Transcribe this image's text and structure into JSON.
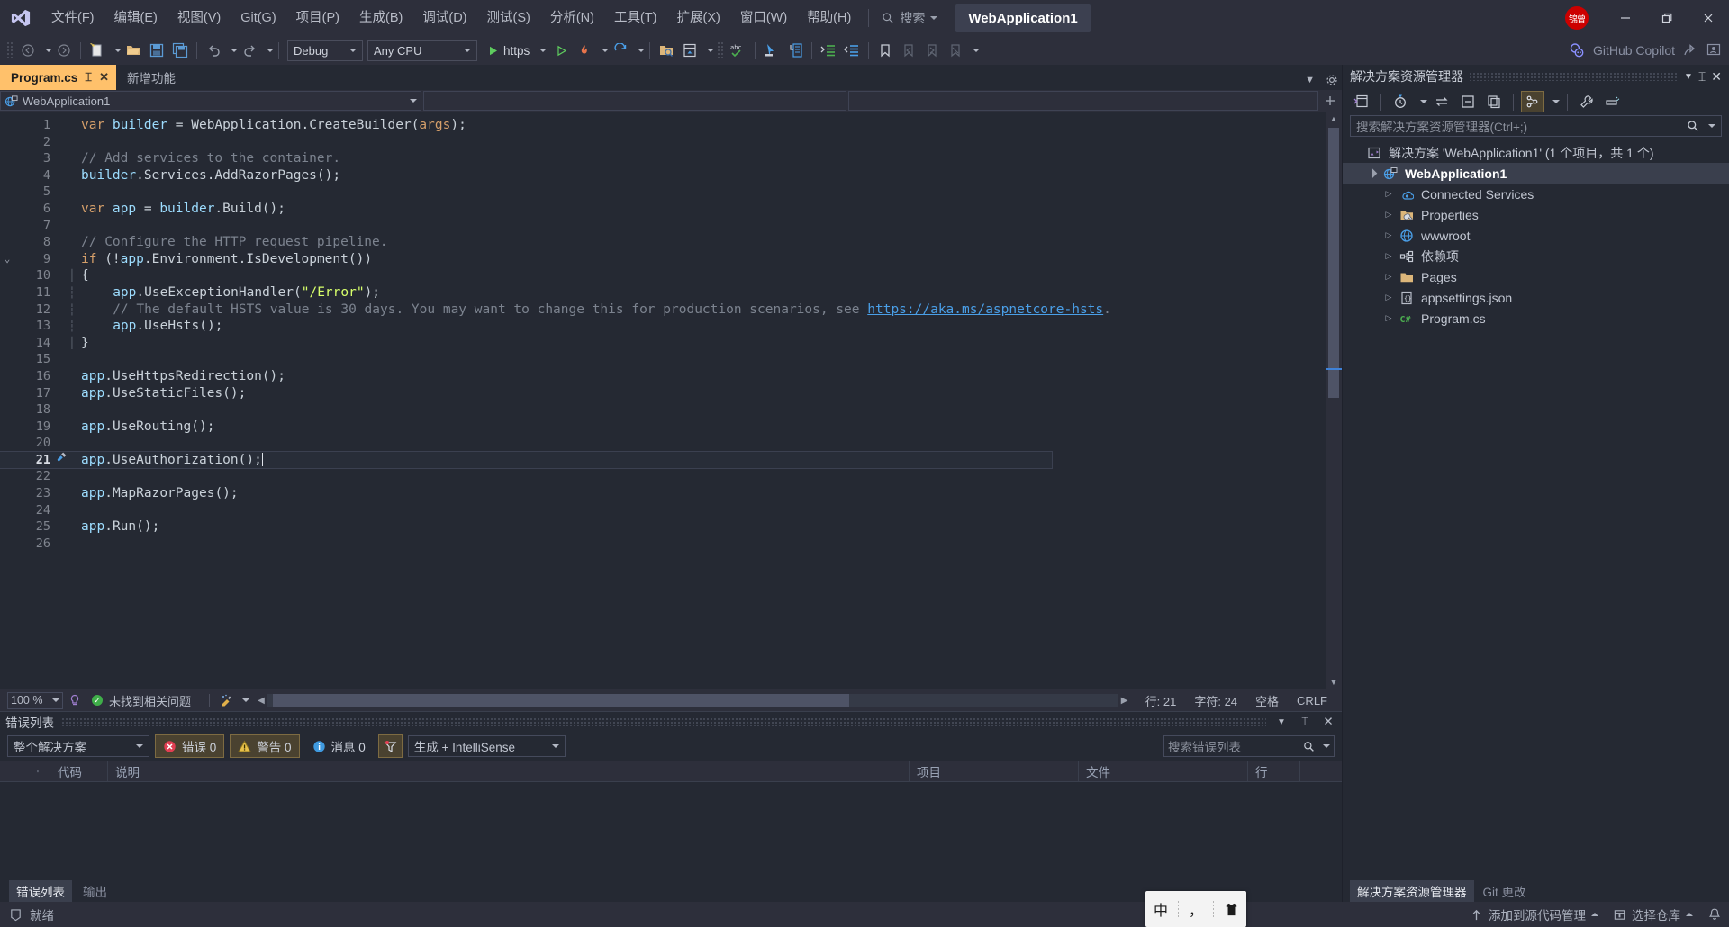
{
  "titlebar": {
    "logo_icon": "visual-studio-logo",
    "menus": [
      "文件(F)",
      "编辑(E)",
      "视图(V)",
      "Git(G)",
      "项目(P)",
      "生成(B)",
      "调试(D)",
      "测试(S)",
      "分析(N)",
      "工具(T)",
      "扩展(X)",
      "窗口(W)",
      "帮助(H)"
    ],
    "search_label": "搜索",
    "search_icon": "search-icon",
    "app_name": "WebApplication1",
    "avatar_text": "锦曾",
    "minimize_icon": "minimize-icon",
    "restore_icon": "restore-icon",
    "close_icon": "close-icon"
  },
  "toolbar": {
    "nav_back_icon": "navigate-back-icon",
    "nav_forward_icon": "navigate-forward-icon",
    "new_project_icon": "new-project-icon",
    "open_icon": "open-file-icon",
    "save_icon": "save-icon",
    "save_all_icon": "save-all-icon",
    "undo_icon": "undo-icon",
    "redo_icon": "redo-icon",
    "config_value": "Debug",
    "platform_value": "Any CPU",
    "run_label": "https",
    "run_icon": "play-icon",
    "run_no_debug_icon": "play-outline-icon",
    "hotreload_icon": "hot-reload-icon",
    "restart_icon": "restart-icon",
    "solution_explorer_icon": "solution-explorer-icon",
    "properties_icon": "properties-window-icon",
    "spell_icon": "spell-check-icon",
    "pointer_icon": "select-element-icon",
    "structure_icon": "structure-icon",
    "indent_icon": "indent-icon",
    "outdent_icon": "outdent-icon",
    "bookmark_icon": "bookmark-icon",
    "bookmark_prev_icon": "bookmark-prev-icon",
    "bookmark_next_icon": "bookmark-next-icon",
    "bookmark_clear_icon": "bookmark-clear-icon",
    "copilot_label": "GitHub Copilot",
    "copilot_icon": "copilot-icon",
    "share_icon": "share-icon",
    "feedback_icon": "feedback-icon"
  },
  "editor": {
    "tabs": [
      {
        "label": "Program.cs",
        "active": true,
        "pin_icon": "pin-icon",
        "close_icon": "close-icon"
      },
      {
        "label": "新增功能",
        "active": false
      }
    ],
    "nav_project": "WebApplication1",
    "nav_project_icon": "web-project-icon",
    "nav_member": "",
    "nav_type": "",
    "add_icon": "add-icon",
    "lines": [
      {
        "n": 1,
        "tokens": [
          {
            "t": "var ",
            "c": "kwv"
          },
          {
            "t": "builder ",
            "c": "var"
          },
          {
            "t": "= ",
            "c": "punc"
          },
          {
            "t": "WebApplication",
            "c": "id"
          },
          {
            "t": ".",
            "c": "punc"
          },
          {
            "t": "CreateBuilder",
            "c": "id"
          },
          {
            "t": "(",
            "c": "punc"
          },
          {
            "t": "args",
            "c": "param"
          },
          {
            "t": ");",
            "c": "punc"
          }
        ]
      },
      {
        "n": 2,
        "tokens": []
      },
      {
        "n": 3,
        "tokens": [
          {
            "t": "// Add services to the container.",
            "c": "cmt"
          }
        ]
      },
      {
        "n": 4,
        "tokens": [
          {
            "t": "builder",
            "c": "var"
          },
          {
            "t": ".",
            "c": "punc"
          },
          {
            "t": "Services",
            "c": "id"
          },
          {
            "t": ".",
            "c": "punc"
          },
          {
            "t": "AddRazorPages",
            "c": "id"
          },
          {
            "t": "();",
            "c": "punc"
          }
        ]
      },
      {
        "n": 5,
        "tokens": []
      },
      {
        "n": 6,
        "tokens": [
          {
            "t": "var ",
            "c": "kwv"
          },
          {
            "t": "app ",
            "c": "var"
          },
          {
            "t": "= ",
            "c": "punc"
          },
          {
            "t": "builder",
            "c": "var"
          },
          {
            "t": ".",
            "c": "punc"
          },
          {
            "t": "Build",
            "c": "id"
          },
          {
            "t": "();",
            "c": "punc"
          }
        ]
      },
      {
        "n": 7,
        "tokens": []
      },
      {
        "n": 8,
        "tokens": [
          {
            "t": "// Configure the HTTP request pipeline.",
            "c": "cmt"
          }
        ]
      },
      {
        "n": 9,
        "fold": "collapse",
        "tokens": [
          {
            "t": "if ",
            "c": "kwv"
          },
          {
            "t": "(!",
            "c": "punc"
          },
          {
            "t": "app",
            "c": "var"
          },
          {
            "t": ".",
            "c": "punc"
          },
          {
            "t": "Environment",
            "c": "id"
          },
          {
            "t": ".",
            "c": "punc"
          },
          {
            "t": "IsDevelopment",
            "c": "id"
          },
          {
            "t": "())",
            "c": "punc"
          }
        ]
      },
      {
        "n": 10,
        "bar": "solid",
        "tokens": [
          {
            "t": "{",
            "c": "punc"
          }
        ]
      },
      {
        "n": 11,
        "bar": "dash",
        "indent": 4,
        "tokens": [
          {
            "t": "app",
            "c": "var"
          },
          {
            "t": ".",
            "c": "punc"
          },
          {
            "t": "UseExceptionHandler",
            "c": "id"
          },
          {
            "t": "(",
            "c": "punc"
          },
          {
            "t": "\"/Error\"",
            "c": "str"
          },
          {
            "t": ");",
            "c": "punc"
          }
        ]
      },
      {
        "n": 12,
        "bar": "dash",
        "indent": 4,
        "tokens": [
          {
            "t": "// The default HSTS value is 30 days. You may want to change this for production scenarios, see ",
            "c": "cmt"
          },
          {
            "t": "https://aka.ms/aspnetcore-hsts",
            "c": "link"
          },
          {
            "t": ".",
            "c": "cmt"
          }
        ]
      },
      {
        "n": 13,
        "bar": "dash",
        "indent": 4,
        "tokens": [
          {
            "t": "app",
            "c": "var"
          },
          {
            "t": ".",
            "c": "punc"
          },
          {
            "t": "UseHsts",
            "c": "id"
          },
          {
            "t": "();",
            "c": "punc"
          }
        ]
      },
      {
        "n": 14,
        "bar": "solid",
        "tokens": [
          {
            "t": "}",
            "c": "punc"
          }
        ]
      },
      {
        "n": 15,
        "tokens": []
      },
      {
        "n": 16,
        "tokens": [
          {
            "t": "app",
            "c": "var"
          },
          {
            "t": ".",
            "c": "punc"
          },
          {
            "t": "UseHttpsRedirection",
            "c": "id"
          },
          {
            "t": "();",
            "c": "punc"
          }
        ]
      },
      {
        "n": 17,
        "tokens": [
          {
            "t": "app",
            "c": "var"
          },
          {
            "t": ".",
            "c": "punc"
          },
          {
            "t": "UseStaticFiles",
            "c": "id"
          },
          {
            "t": "();",
            "c": "punc"
          }
        ]
      },
      {
        "n": 18,
        "tokens": []
      },
      {
        "n": 19,
        "tokens": [
          {
            "t": "app",
            "c": "var"
          },
          {
            "t": ".",
            "c": "punc"
          },
          {
            "t": "UseRouting",
            "c": "id"
          },
          {
            "t": "();",
            "c": "punc"
          }
        ]
      },
      {
        "n": 20,
        "tokens": []
      },
      {
        "n": 21,
        "current": true,
        "quickaction": "screwdriver-icon",
        "tokens": [
          {
            "t": "app",
            "c": "var"
          },
          {
            "t": ".",
            "c": "punc"
          },
          {
            "t": "UseAuthorization",
            "c": "id"
          },
          {
            "t": "();",
            "c": "punc"
          }
        ]
      },
      {
        "n": 22,
        "tokens": []
      },
      {
        "n": 23,
        "tokens": [
          {
            "t": "app",
            "c": "var"
          },
          {
            "t": ".",
            "c": "punc"
          },
          {
            "t": "MapRazorPages",
            "c": "id"
          },
          {
            "t": "();",
            "c": "punc"
          }
        ]
      },
      {
        "n": 24,
        "tokens": []
      },
      {
        "n": 25,
        "tokens": [
          {
            "t": "app",
            "c": "var"
          },
          {
            "t": ".",
            "c": "punc"
          },
          {
            "t": "Run",
            "c": "id"
          },
          {
            "t": "();",
            "c": "punc"
          }
        ]
      },
      {
        "n": 26,
        "tokens": []
      }
    ],
    "status": {
      "zoom": "100 %",
      "issues_icon": "lightbulb-icon",
      "issues_text": "未找到相关问题",
      "broom_icon": "code-cleanup-icon",
      "line_label": "行: 21",
      "col_label": "字符: 24",
      "space_label": "空格",
      "eol_label": "CRLF"
    }
  },
  "error_list": {
    "title": "错误列表",
    "scope_value": "整个解决方案",
    "errors_label": "错误 0",
    "warnings_label": "警告 0",
    "messages_label": "消息 0",
    "filter_icon": "filter-icon",
    "build_filter_value": "生成 + IntelliSense",
    "search_placeholder": "搜索错误列表",
    "search_icon": "search-icon",
    "columns": [
      "",
      "",
      "代码",
      "说明",
      "项目",
      "文件",
      "行"
    ],
    "rows": [],
    "footer_tabs": [
      {
        "label": "错误列表",
        "active": true
      },
      {
        "label": "输出",
        "active": false
      }
    ],
    "dropdown_icon": "chevron-down-icon",
    "pin_icon": "pin-icon",
    "close_icon": "close-icon"
  },
  "solution_explorer": {
    "title": "解决方案资源管理器",
    "dropdown_icon": "chevron-down-icon",
    "pin_icon": "pin-icon",
    "close_icon": "close-icon",
    "toolbar_icons": [
      "code-view-icon",
      "pending-changes-icon",
      "sync-icon",
      "collapse-all-icon",
      "copy-icon",
      "show-all-files-icon",
      "properties-icon",
      "preview-icon"
    ],
    "search_placeholder": "搜索解决方案资源管理器(Ctrl+;)",
    "search_icon": "search-icon",
    "tree": [
      {
        "label": "解决方案 'WebApplication1' (1 个项目，共 1 个)",
        "depth": 0,
        "icon": "solution-icon",
        "arrow": "none",
        "selected": false
      },
      {
        "label": "WebApplication1",
        "depth": 1,
        "icon": "web-project-icon",
        "arrow": "expanded",
        "selected": true
      },
      {
        "label": "Connected Services",
        "depth": 2,
        "icon": "connected-services-icon",
        "arrow": "collapsed",
        "selected": false
      },
      {
        "label": "Properties",
        "depth": 2,
        "icon": "properties-folder-icon",
        "arrow": "collapsed",
        "selected": false
      },
      {
        "label": "wwwroot",
        "depth": 2,
        "icon": "globe-icon",
        "arrow": "collapsed",
        "selected": false
      },
      {
        "label": "依赖项",
        "depth": 2,
        "icon": "dependencies-icon",
        "arrow": "collapsed",
        "selected": false
      },
      {
        "label": "Pages",
        "depth": 2,
        "icon": "folder-icon",
        "arrow": "collapsed",
        "selected": false
      },
      {
        "label": "appsettings.json",
        "depth": 2,
        "icon": "json-file-icon",
        "arrow": "collapsed",
        "selected": false
      },
      {
        "label": "Program.cs",
        "depth": 2,
        "icon": "csharp-file-icon",
        "arrow": "collapsed",
        "selected": false
      }
    ],
    "footer_tabs": [
      {
        "label": "解决方案资源管理器",
        "active": true
      },
      {
        "label": "Git 更改",
        "active": false
      }
    ]
  },
  "statusbar": {
    "ready_icon": "ready-icon",
    "ready_text": "就绪",
    "add_source_control_label": "添加到源代码管理",
    "add_source_control_icon": "upload-icon",
    "select_repo_label": "选择仓库",
    "select_repo_icon": "repository-icon",
    "notification_icon": "bell-icon"
  },
  "ime": {
    "mode": "中",
    "punctuation": "，",
    "skin_icon": "shirt-icon"
  },
  "colors": {
    "accent_tab": "#ffc16b",
    "chrome": "#2d2f3b",
    "editor_bg": "#252933",
    "selection": "#3a3f4d",
    "link": "#4a9fe8",
    "string": "#d7ff6b",
    "keyword": "#d59f6a",
    "identifier": "#9cdcfe",
    "comment": "#7c838f",
    "error_red": "#e03e52",
    "warn_yellow": "#e8c14a",
    "info_blue": "#3f9ae0",
    "ok_green": "#3fae49",
    "avatar_red": "#cc0000"
  }
}
